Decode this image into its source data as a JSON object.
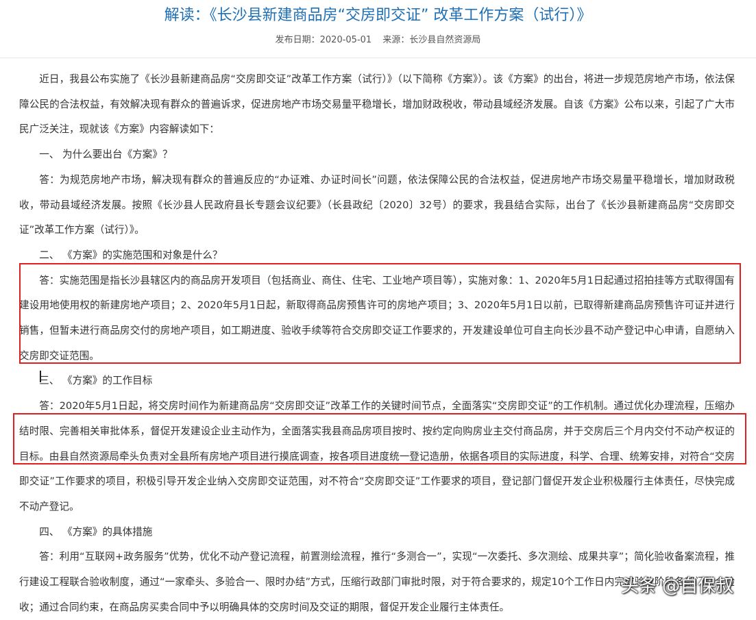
{
  "article": {
    "title": "解读：《长沙县新建商品房“交房即交证” 改革工作方案（试行）》",
    "publish_date": "发布日期：2020-05-01",
    "source": "来源：长沙县自然资源局"
  },
  "paragraphs": [
    "近日，我县公布实施了《长沙县新建商品房“交房即交证”改革工作方案（试行）》（以下简称《方案》）。该《方案》的出台，将进一步规范房地产市场，依法保障公民的合法权益，有效解决现有群众的普遍诉求，促进房地产市场交易量平稳增长，增加财政税收，带动县域经济发展。自该《方案》公布以来，引起了广大市民广泛关注，现就该《方案》内容解读如下：",
    "一、 为什么要出台《方案》？",
    "答：为规范房地产市场，解决现有群众的普遍反应的“办证难、办证时间长”问题，依法保障公民的合法权益，促进房地产市场交易量平稳增长，增加财政税收，带动县域经济发展。按照《长沙县人民政府县长专题会议纪要》（长县政纪〔2020〕32号）的要求，我县结合实际，出台了《长沙县新建商品房“交房即交证”改革工作方案（试行）》。",
    "二、 《方案》的实施范围和对象是什么？",
    "答：实施范围是指长沙县辖区内的商品房开发项目（包括商业、商住、住宅、工业地产项目等），实施对象：1、2020年5月1日起通过招拍挂等方式取得国有建设用地使用权的新建房地产项目；2、2020年5月1日起，新取得商品房预售许可的房地产项目；3、2020年5月1日以前，已取得新建商品房预售许可证并进行销售，但暂未进行商品房交付的房地产项目，如工期进度、验收手续等符合交房即交证工作要求的，开发建设单位可自主向长沙县不动产登记中心申请，自愿纳入交房即交证范围。",
    "三、 《方案》的工作目标",
    "答：2020年5月1日起，将交房时间作为新建商品房“交房即交证”改革工作的关键时间节点，全面落实“交房即交证”的工作机制。通过优化办理流程，压缩办结时限、完善相关审批体系，督促开发建设企业主动作为，全面落实我县商品房项目按时、按约定向购房业主交付商品房，并于交房后三个月内交付不动产权证的目标。由县自然资源局牵头负责对全县所有房地产项目进行摸底调查，按各项目进度统一登记造册，依据各项目的实际进度，科学、合理、统筹安排，对符合“交房即交证”工作要求的项目，积极引导开发企业纳入交房即交证范围，对不符合“交房即交证”工作要求的项目，登记部门督促开发企业积极履行主体责任，尽快完成不动产登记。",
    "四、 《方案》的具体措施",
    "答：利用“互联网+政务服务”优势，优化不动产登记流程，前置测绘流程，推行“多测合一”，实现“一次委托、多次测绘、成果共享”；简化验收备案流程，推行建设工程联合验收制度，通过“一家牵头、多验合一、限时办结”方式，压缩行政部门审批时限，对于符合要求的，规定10个工作日内完成验收阶段各部门联合验收；通过合同约束，在商品房买卖合同中予以明确具体的交房时间及交证的期限，督促开发企业履行主体责任。"
  ],
  "watermark": "头条 @自保叔",
  "colors": {
    "title": "#1f6fb5",
    "text": "#333333",
    "highlight_box": "#e02020"
  }
}
